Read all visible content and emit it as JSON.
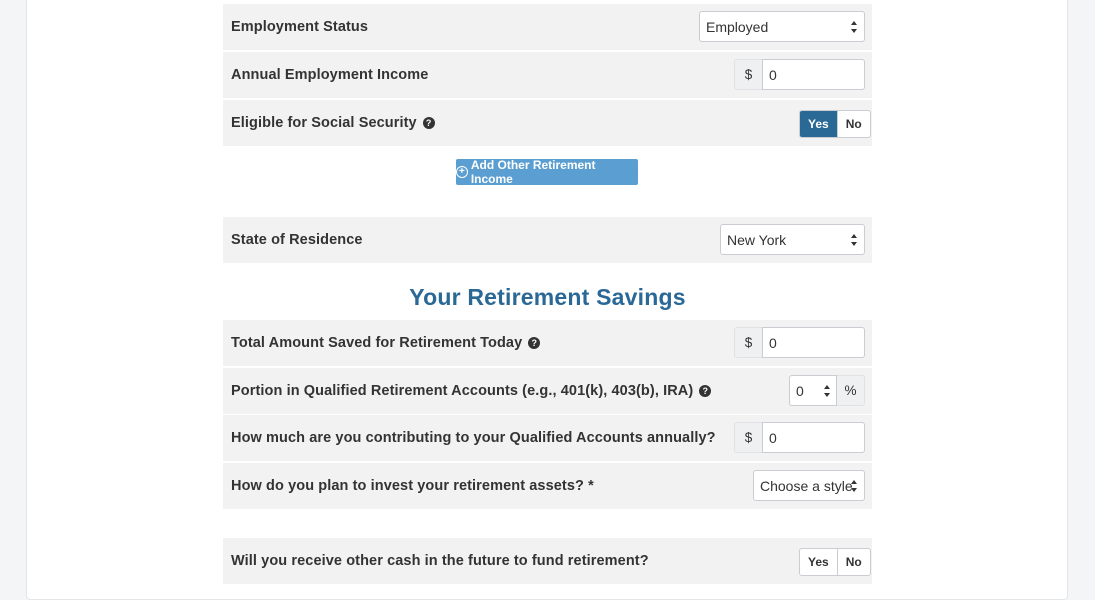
{
  "income": {
    "employment_status": {
      "label": "Employment Status",
      "value": "Employed"
    },
    "annual_income": {
      "label": "Annual Employment Income",
      "currency": "$",
      "value": "0"
    },
    "social_security": {
      "label": "Eligible for Social Security",
      "yes": "Yes",
      "no": "No",
      "selected": "Yes"
    },
    "add_button": "Add Other Retirement Income"
  },
  "residence": {
    "label": "State of Residence",
    "value": "New York"
  },
  "savings": {
    "title": "Your Retirement Savings",
    "total_saved": {
      "label": "Total Amount Saved for Retirement Today",
      "currency": "$",
      "value": "0"
    },
    "qualified_portion": {
      "label": "Portion in Qualified Retirement Accounts (e.g., 401(k), 403(b), IRA)",
      "value": "0",
      "suffix": "%"
    },
    "annual_contribution": {
      "label": "How much are you contributing to your Qualified Accounts annually?",
      "currency": "$",
      "value": "0"
    },
    "investment_style": {
      "label": "How do you plan to invest your retirement assets? *",
      "value": "Choose a style"
    },
    "other_cash": {
      "label": "Will you receive other cash in the future to fund retirement?",
      "yes": "Yes",
      "no": "No",
      "selected": ""
    }
  },
  "colors": {
    "primary": "#2a6896",
    "button": "#5b9ed1",
    "row_bg": "#f2f2f2"
  },
  "icons": {
    "help": "question-circle-icon",
    "add": "plus-circle-icon",
    "select": "sort-arrows-icon"
  }
}
